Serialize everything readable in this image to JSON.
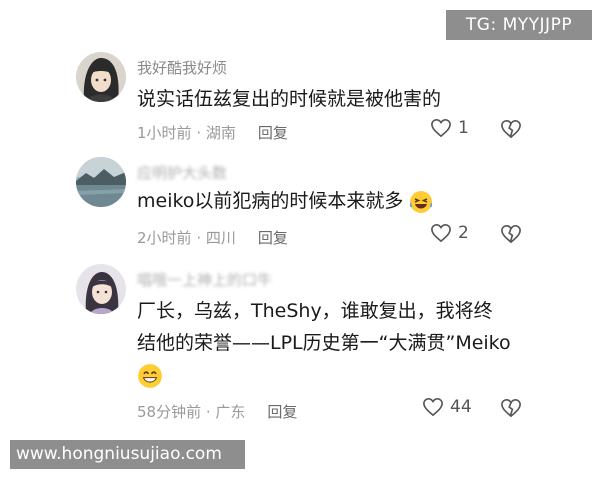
{
  "watermarks": {
    "tg": "TG: MYYJJPP",
    "url": "www.hongniusujiao.com"
  },
  "comments": [
    {
      "username": "我好酷我好烦",
      "text_lines": [
        "说实话伍兹复出的时候就是被他害的"
      ],
      "time": "1小时前",
      "location": "湖南",
      "reply_label": "回复",
      "likes": "1",
      "avatar_icon": "anime-avatar-icon"
    },
    {
      "username": "应明护大头数",
      "text_lines": [
        "meiko以前犯病的时候本来就多"
      ],
      "trailing_emoji": "laughing-crying-emoji-icon",
      "time": "2小时前",
      "location": "四川",
      "reply_label": "回复",
      "likes": "2",
      "avatar_icon": "lake-landscape-avatar-icon"
    },
    {
      "username": "唱哦一上神上的口牛",
      "text_lines": [
        "厂长，乌兹，TheShy，谁敢复出，我将终",
        "结他的荣誉——LPL历史第一“大满贯”Meiko"
      ],
      "trailing_emoji": "grinning-emoji-icon",
      "time": "58分钟前",
      "location": "广东",
      "reply_label": "回复",
      "likes": "44",
      "avatar_icon": "girl-avatar-icon"
    }
  ],
  "meta_separator": " · "
}
